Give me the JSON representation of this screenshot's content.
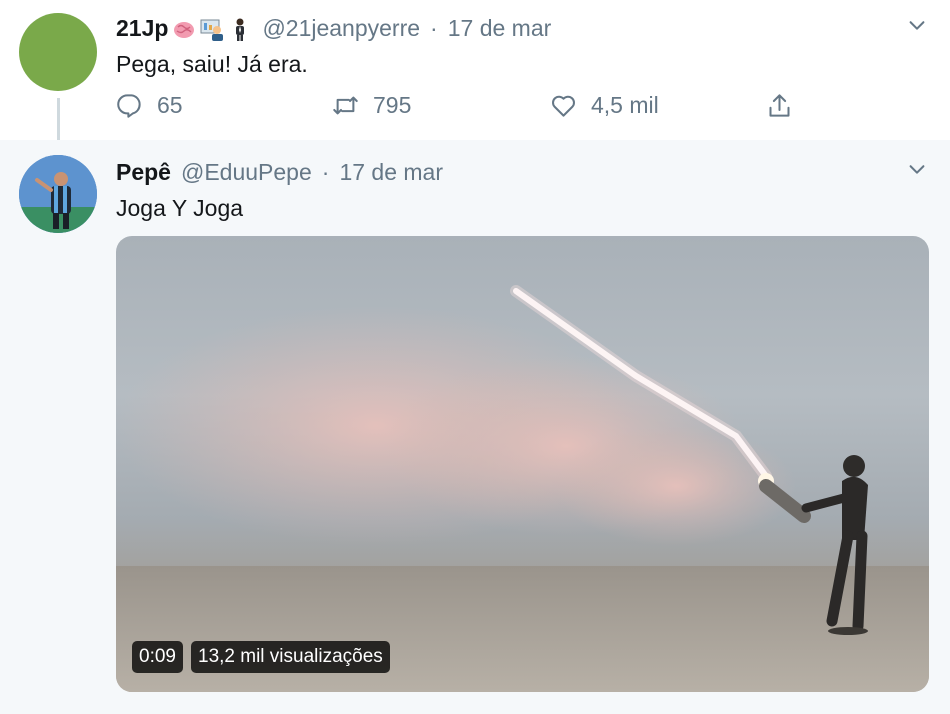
{
  "tweet1": {
    "name": "21Jp",
    "handle": "@21jeanpyerre",
    "dot": "·",
    "date": "17 de mar",
    "text": "Pega, saiu! Já era.",
    "emojis": [
      "brain-icon",
      "teacher-icon",
      "businessperson-icon"
    ],
    "replies": "65",
    "retweets": "795",
    "likes": "4,5 mil"
  },
  "tweet2": {
    "name": "Pepê",
    "handle": "@EduuPepe",
    "dot": "·",
    "date": "17 de mar",
    "text": "Joga Y Joga",
    "video": {
      "duration": "0:09",
      "views": "13,2 mil visualizações"
    }
  },
  "colors": {
    "secondary_text": "#657786",
    "thread_bg": "#f5f8fa",
    "avatar1": "#7aa94a"
  }
}
